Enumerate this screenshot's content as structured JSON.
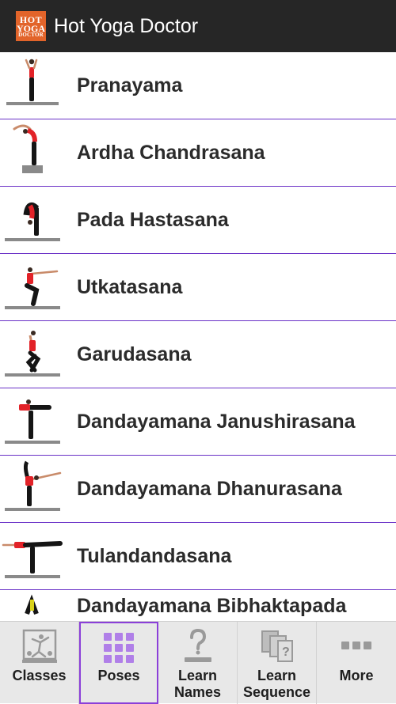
{
  "app": {
    "title": "Hot Yoga Doctor",
    "logo_line1": "HOT",
    "logo_line2": "YOGA",
    "logo_line3": "DOCTOR"
  },
  "poses": [
    {
      "label": "Pranayama"
    },
    {
      "label": "Ardha Chandrasana"
    },
    {
      "label": "Pada Hastasana"
    },
    {
      "label": "Utkatasana"
    },
    {
      "label": "Garudasana"
    },
    {
      "label": "Dandayamana Janushirasana"
    },
    {
      "label": "Dandayamana Dhanurasana"
    },
    {
      "label": "Tulandandasana"
    },
    {
      "label": "Dandayamana Bibhaktapada"
    }
  ],
  "tabs": [
    {
      "label": "Classes",
      "icon": "classes-icon",
      "selected": false
    },
    {
      "label": "Poses",
      "icon": "grid-icon",
      "selected": true
    },
    {
      "label": "Learn\nNames",
      "icon": "question-icon",
      "selected": false
    },
    {
      "label": "Learn\nSequence",
      "icon": "cards-icon",
      "selected": false
    },
    {
      "label": "More",
      "icon": "more-icon",
      "selected": false
    }
  ],
  "colors": {
    "appbar": "#262626",
    "accent": "#8b3fd9",
    "divider": "#6a31c7",
    "logo": "#e2642a",
    "figure_top": "#e22228"
  }
}
